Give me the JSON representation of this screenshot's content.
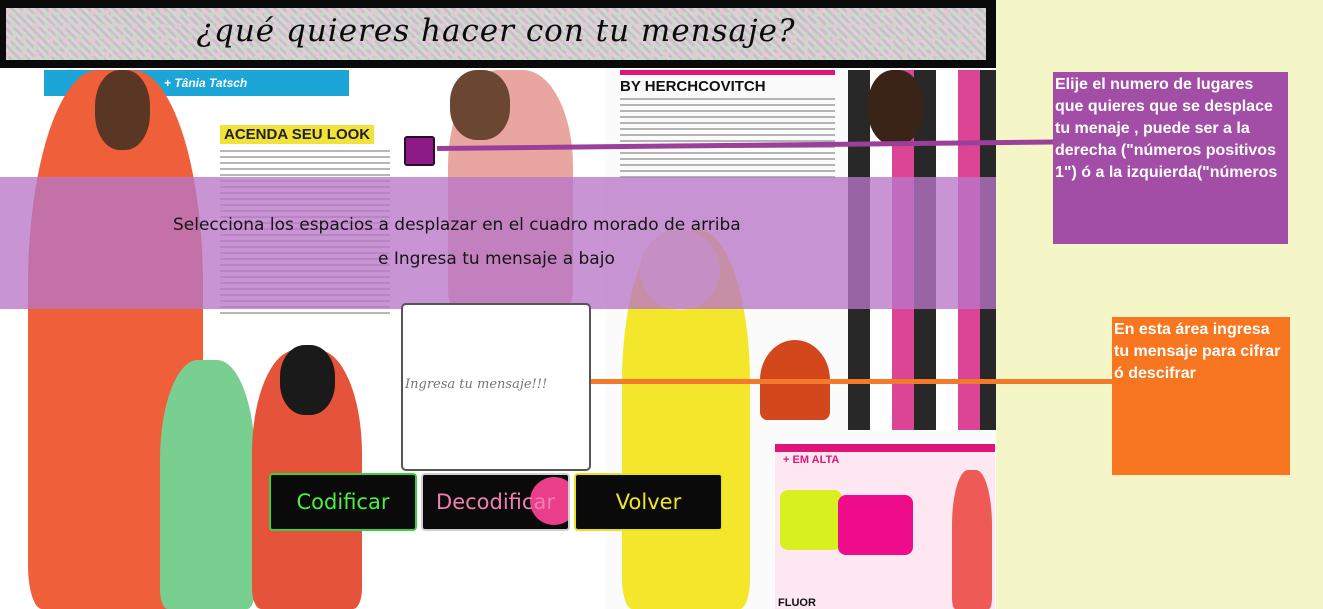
{
  "header": {
    "title": "¿qué quieres hacer con tu mensaje?"
  },
  "background": {
    "magazine_left_credit": "+ Tânia Tatsch",
    "magazine_heading_left": "ACENDA SEU LOOK",
    "magazine_heading_right": "BY HERCHCOVITCH",
    "magazine_tag_em_alta": "+ EM ALTA",
    "magazine_tag_fluor": "FLUOR"
  },
  "instructions": {
    "line1": "Selecciona los espacios a desplazar en el cuadro morado de arriba",
    "line2": "e Ingresa tu mensaje a bajo"
  },
  "message": {
    "placeholder": "Ingresa tu mensaje!!!",
    "value": ""
  },
  "buttons": {
    "encode": "Codificar",
    "decode": "Decodificar",
    "back": "Volver"
  },
  "notes": {
    "shift": "Elije el numero de lugares que quieres que se desplace tu menaje , puede ser a la derecha (\"números positivos 1\") ó a la izquierda(\"números",
    "message": "En esta área ingresa tu mensaje para cifrar ó descifrar"
  },
  "colors": {
    "page_background": "#f4f6c8",
    "instruction_overlay": "#b876c8",
    "shift_box": "#8e1a86",
    "note_purple": "#a34ea6",
    "note_orange": "#f8761f",
    "encode_accent": "#4ef040",
    "decode_accent": "#f07fb2",
    "back_accent": "#f1e820"
  }
}
